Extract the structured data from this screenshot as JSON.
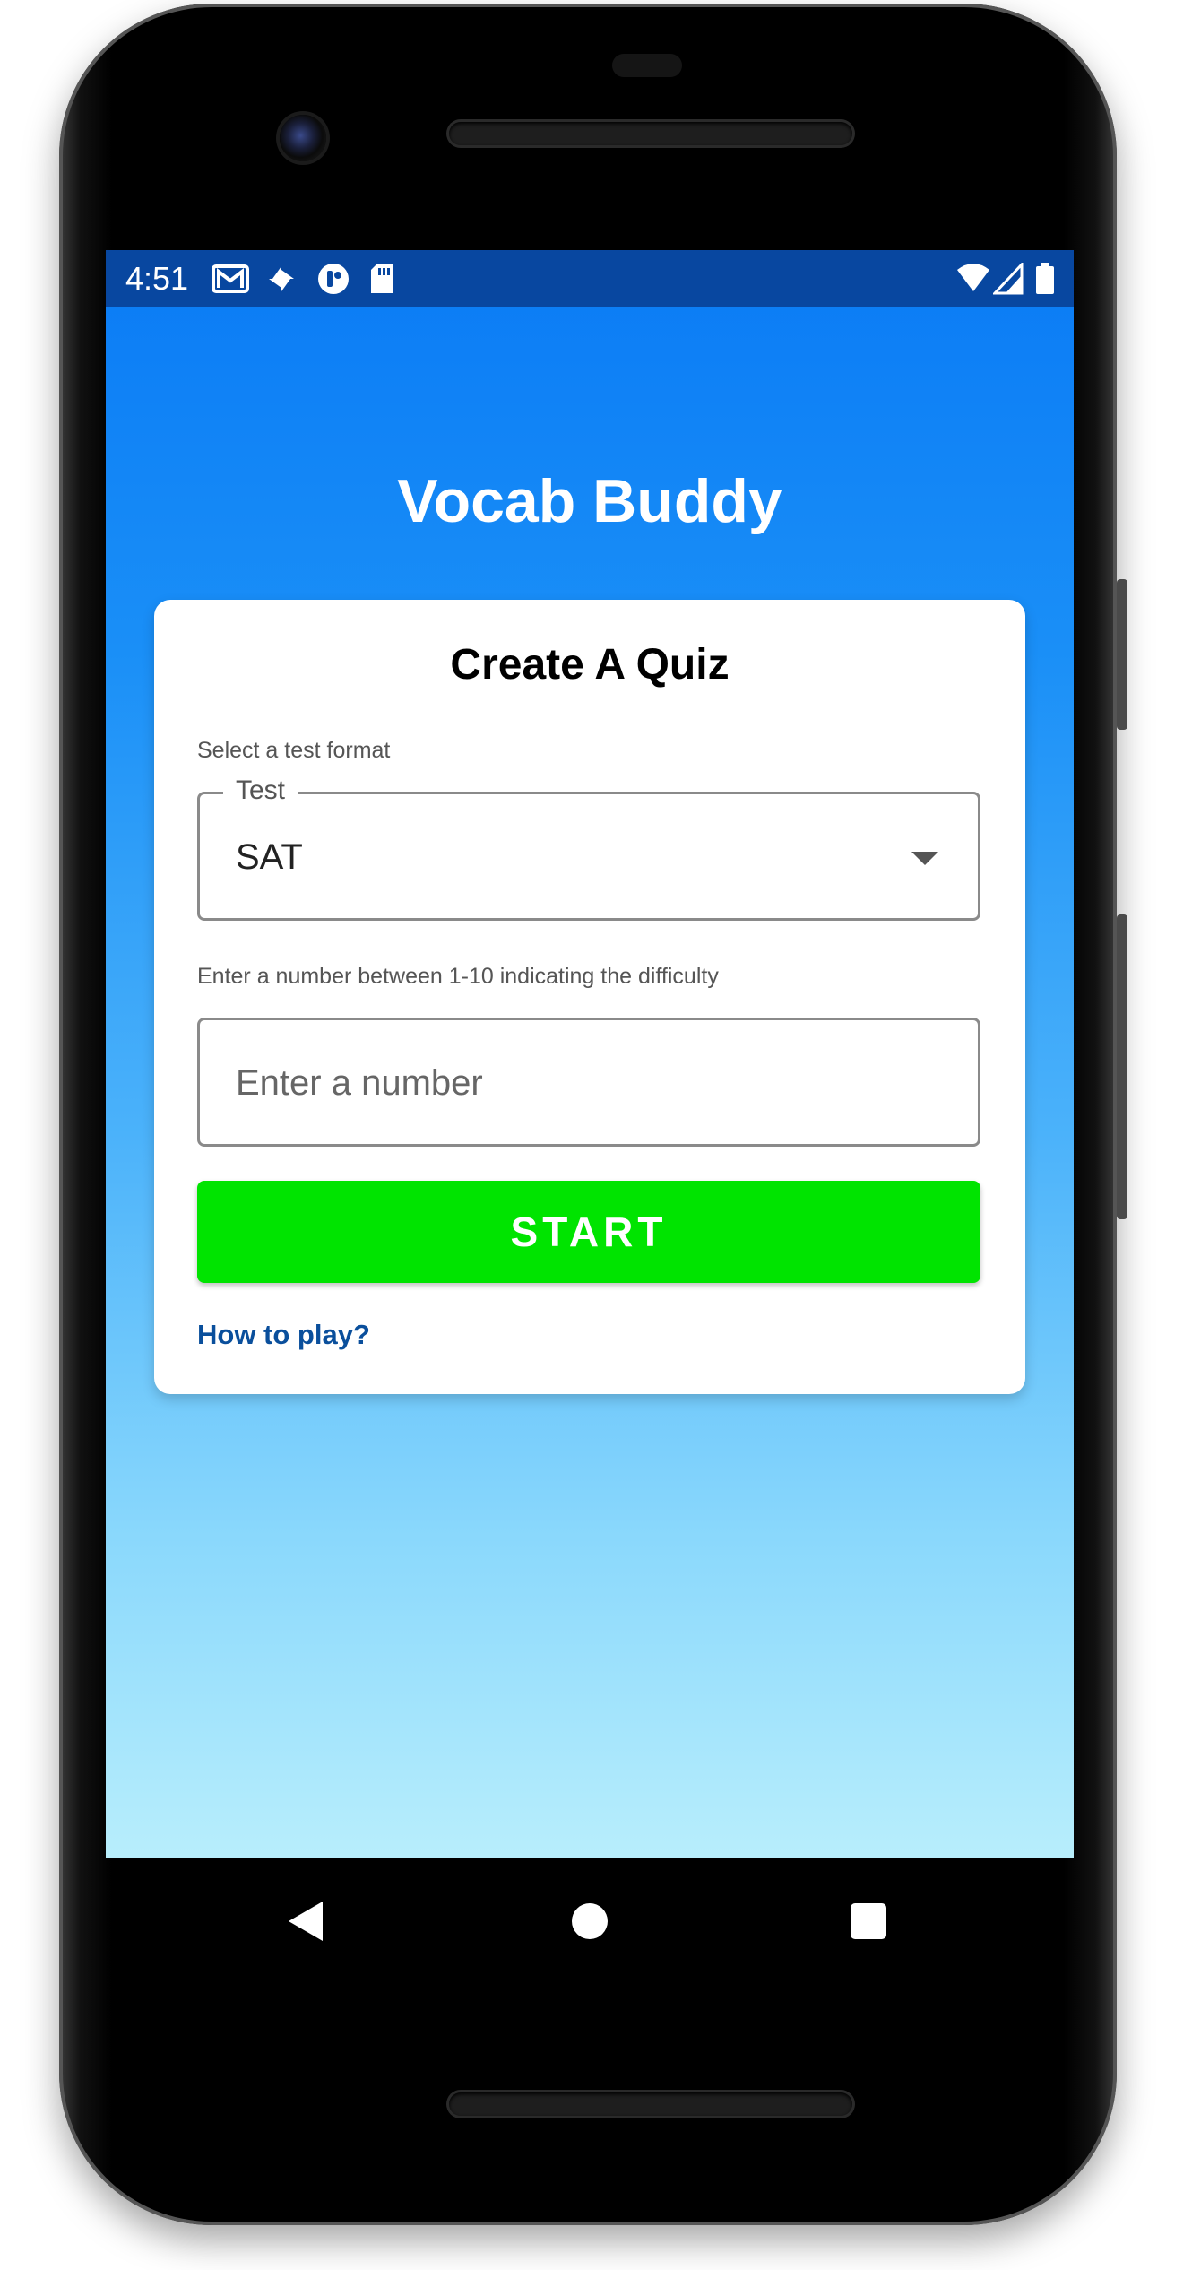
{
  "status_bar": {
    "time": "4:51",
    "left_icons": [
      "gmail-icon",
      "pinwheel-icon",
      "app-notification-icon",
      "sd-card-icon"
    ],
    "right_icons": [
      "wifi-icon",
      "cellular-signal-icon",
      "battery-icon"
    ]
  },
  "app": {
    "title": "Vocab Buddy"
  },
  "quiz_card": {
    "title": "Create A Quiz",
    "format_helper": "Select a test format",
    "format_field": {
      "label": "Test",
      "value": "SAT"
    },
    "difficulty_helper": "Enter a number between 1-10 indicating the difficulty",
    "difficulty_field": {
      "placeholder": "Enter a number",
      "value": ""
    },
    "start_label": "START",
    "how_to_play_label": "How to play?"
  },
  "navigation_bar": {
    "buttons": [
      "back-icon",
      "home-icon",
      "recents-icon"
    ]
  },
  "colors": {
    "status_bar": "#0847a0",
    "background_top": "#0a7bf5",
    "background_bottom": "#b8eefc",
    "start_button": "#00e400",
    "link": "#0a4f9c"
  }
}
